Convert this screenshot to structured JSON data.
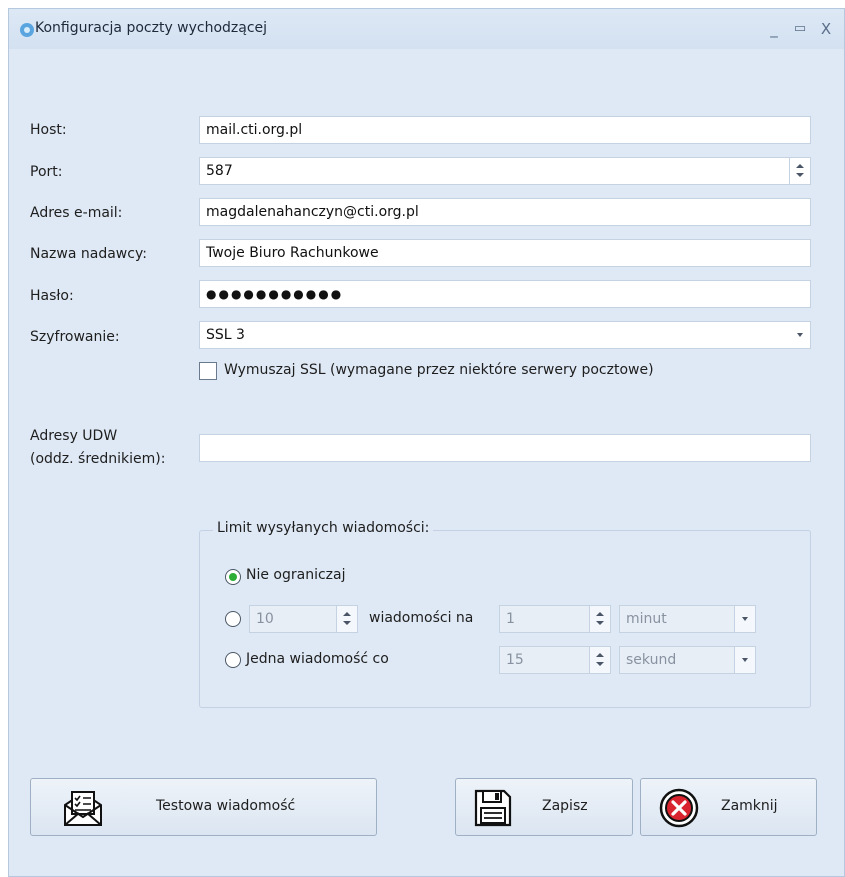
{
  "window": {
    "title": "Konfiguracja poczty wychodzącej",
    "controls": {
      "minimize": "_",
      "maximize": "▭",
      "close": "X"
    }
  },
  "form": {
    "host": {
      "label": "Host:",
      "value": "mail.cti.org.pl"
    },
    "port": {
      "label": "Port:",
      "value": "587"
    },
    "email": {
      "label": "Adres e-mail:",
      "value": "magdalenahanczyn@cti.org.pl"
    },
    "sender": {
      "label": "Nazwa nadawcy:",
      "value": "Twoje Biuro Rachunkowe"
    },
    "password": {
      "label": "Hasło:",
      "value": "●●●●●●●●●●●"
    },
    "encryption": {
      "label": "Szyfrowanie:",
      "value": "SSL 3"
    },
    "force_ssl": {
      "label": "Wymuszaj SSL (wymagane przez niektóre serwery pocztowe)",
      "checked": false
    },
    "bcc": {
      "label_line1": "Adresy UDW",
      "label_line2": "(oddz. średnikiem):",
      "value": ""
    }
  },
  "limit": {
    "title": "Limit wysyłanych wiadomości:",
    "option_unlimited": {
      "label": "Nie ograniczaj",
      "selected": true
    },
    "option_per": {
      "count": "10",
      "label": "wiadomości na",
      "period": "1",
      "unit": "minut",
      "selected": false
    },
    "option_interval": {
      "label": "Jedna wiadomość co",
      "interval": "15",
      "unit": "sekund",
      "selected": false
    }
  },
  "buttons": {
    "test": "Testowa wiadomość",
    "save": "Zapisz",
    "close": "Zamknij"
  },
  "colors": {
    "radio_selected": "#2fae37",
    "close_icon": "#d9232e",
    "window_bg": "#dfe9f5"
  }
}
